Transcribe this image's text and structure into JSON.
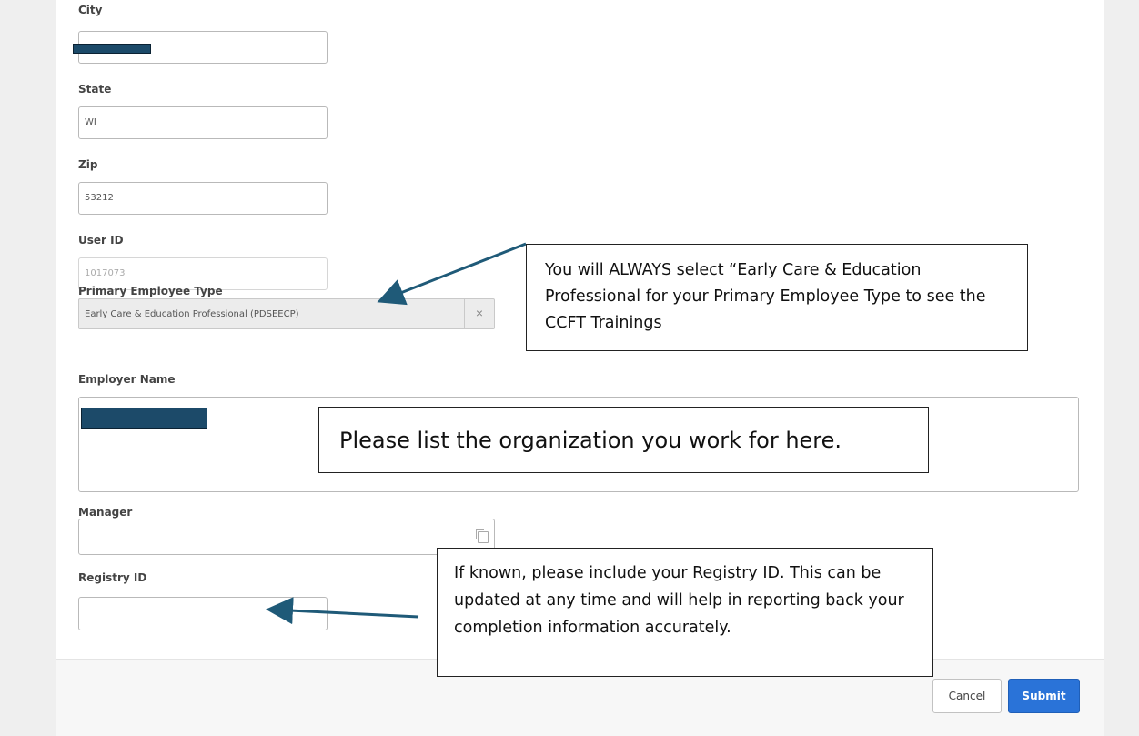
{
  "form": {
    "city": {
      "label": "City",
      "value": ""
    },
    "state": {
      "label": "State",
      "value": "WI"
    },
    "zip": {
      "label": "Zip",
      "value": "53212"
    },
    "user_id": {
      "label": "User ID",
      "value": "1017073"
    },
    "primary_employee_type": {
      "label": "Primary Employee Type",
      "selected": "Early Care & Education Professional (PDSEECP)",
      "clear_glyph": "×"
    },
    "employer_name": {
      "label": "Employer Name",
      "value": ""
    },
    "manager": {
      "label": "Manager",
      "value": "",
      "icon": "lookup-icon"
    },
    "registry_id": {
      "label": "Registry ID",
      "value": ""
    }
  },
  "buttons": {
    "cancel": "Cancel",
    "submit": "Submit"
  },
  "annotations": {
    "employee_type_note": "You will ALWAYS select “Early Care & Education Professional for your Primary Employee Type to see the CCFT Trainings",
    "employer_note": "Please list the organization you work for here.",
    "registry_note": "If known, please include your Registry ID. This can be updated at any time and will help in reporting back your completion information accurately."
  },
  "colors": {
    "submit": "#2a73d8",
    "redaction": "#1c4a69",
    "arrow": "#1f5a78"
  }
}
